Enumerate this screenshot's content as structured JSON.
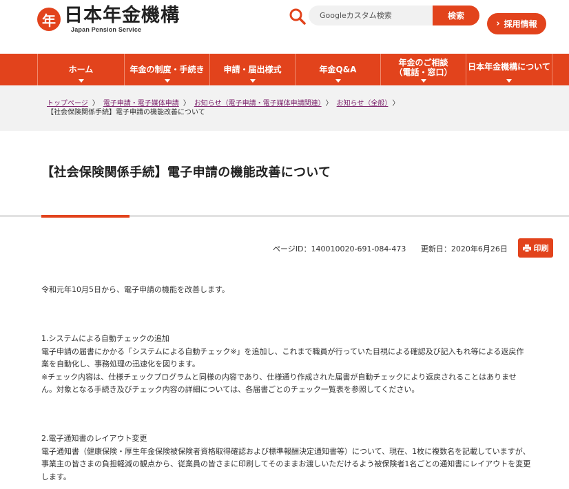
{
  "header": {
    "logo_mark": "年",
    "logo_jp": "日本年金機構",
    "logo_en": "Japan Pension Service",
    "search_placeholder": "Googleカスタム検索",
    "search_button": "検索",
    "recruit_button": "採用情報"
  },
  "nav": {
    "items": [
      {
        "label": "ホーム"
      },
      {
        "label": "年金の制度・手続き"
      },
      {
        "label": "申請・届出様式"
      },
      {
        "label": "年金Q&A"
      },
      {
        "label_line1": "年金のご相談",
        "label_line2": "（電話・窓口）"
      },
      {
        "label": "日本年金機構について"
      }
    ]
  },
  "breadcrumb": {
    "items": [
      "トップページ",
      "電子申請・電子媒体申請",
      "お知らせ（電子申請・電子媒体申請関連）",
      "お知らせ（全般）"
    ],
    "current": "【社会保険関係手続】電子申請の機能改善について",
    "separator": "〉"
  },
  "page": {
    "title": "【社会保険関係手続】電子申請の機能改善について",
    "page_id": "ページID：140010020-691-084-473",
    "updated": "更新日：2020年6月26日",
    "print_label": "印刷"
  },
  "content": {
    "intro": "令和元年10月5日から、電子申請の機能を改善します。",
    "section1": {
      "heading": "1.システムによる自動チェックの追加",
      "line1": "電子申請の届書にかかる「システムによる自動チェック※」を追加し、これまで職員が行っていた目視による確認及び記入もれ等による返戻作",
      "line2": "業を自動化し、事務処理の迅速化を図ります。",
      "line3": "※チェック内容は、仕様チェックプログラムと同様の内容であり、仕様通り作成された届書が自動チェックにより返戻されることはありませ",
      "line4": "ん。対象となる手続き及びチェック内容の詳細については、各届書ごとのチェック一覧表を参照してください。"
    },
    "section2": {
      "heading": "2.電子通知書のレイアウト変更",
      "line1": "電子通知書（健康保険・厚生年金保険被保険者資格取得確認および標準報酬決定通知書等）について、現在、1枚に複数名を記載していますが、",
      "line2": "事業主の皆さまの負担軽減の観点から、従業員の皆さまに印刷してそのままお渡しいただけるよう被保険者1名ごとの通知書にレイアウトを変更",
      "line3": "します。"
    }
  },
  "colors": {
    "brand": "#e2431c",
    "link_visited": "#7a1f69",
    "band": "#f2f2f2"
  }
}
